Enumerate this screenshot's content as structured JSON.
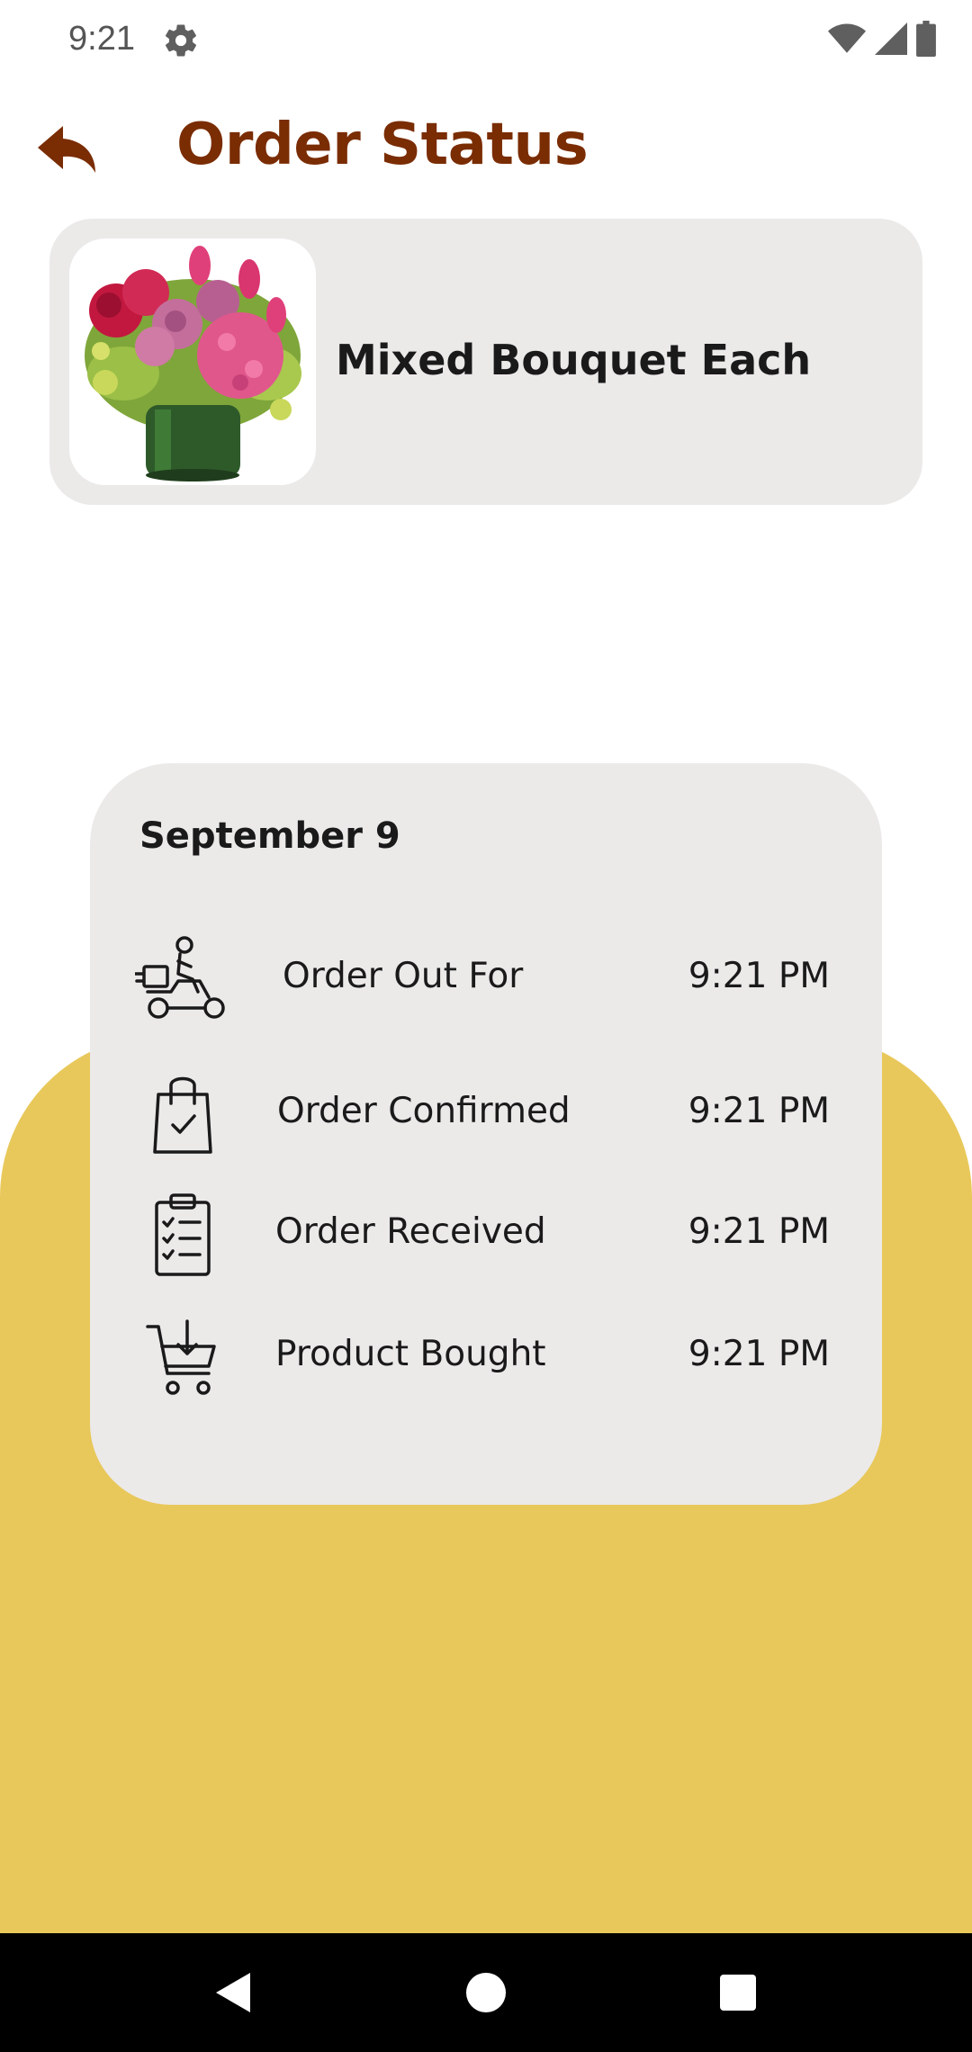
{
  "status_bar": {
    "time": "9:21",
    "icons": [
      "settings-gear-icon",
      "wifi-icon",
      "cellular-signal-icon",
      "battery-icon"
    ]
  },
  "header": {
    "title": "Order Status",
    "back_icon": "back-arrow-icon"
  },
  "product": {
    "name": "Mixed Bouquet Each",
    "image": "flower-bouquet-image"
  },
  "order_status": {
    "date": "September 9",
    "steps": [
      {
        "icon": "delivery-scooter-icon",
        "label": "Order Out For",
        "time": "9:21 PM"
      },
      {
        "icon": "shopping-bag-check-icon",
        "label": "Order Confirmed",
        "time": "9:21 PM"
      },
      {
        "icon": "clipboard-checklist-icon",
        "label": "Order Received",
        "time": "9:21 PM"
      },
      {
        "icon": "cart-download-icon",
        "label": "Product Bought",
        "time": "9:21 PM"
      }
    ]
  },
  "nav_bar": {
    "buttons": [
      "back-triangle-icon",
      "home-circle-icon",
      "recents-square-icon"
    ]
  },
  "colors": {
    "title": "#7a2c02",
    "accent_yellow": "#e8c85a",
    "card_bg": "#ece9e9"
  }
}
